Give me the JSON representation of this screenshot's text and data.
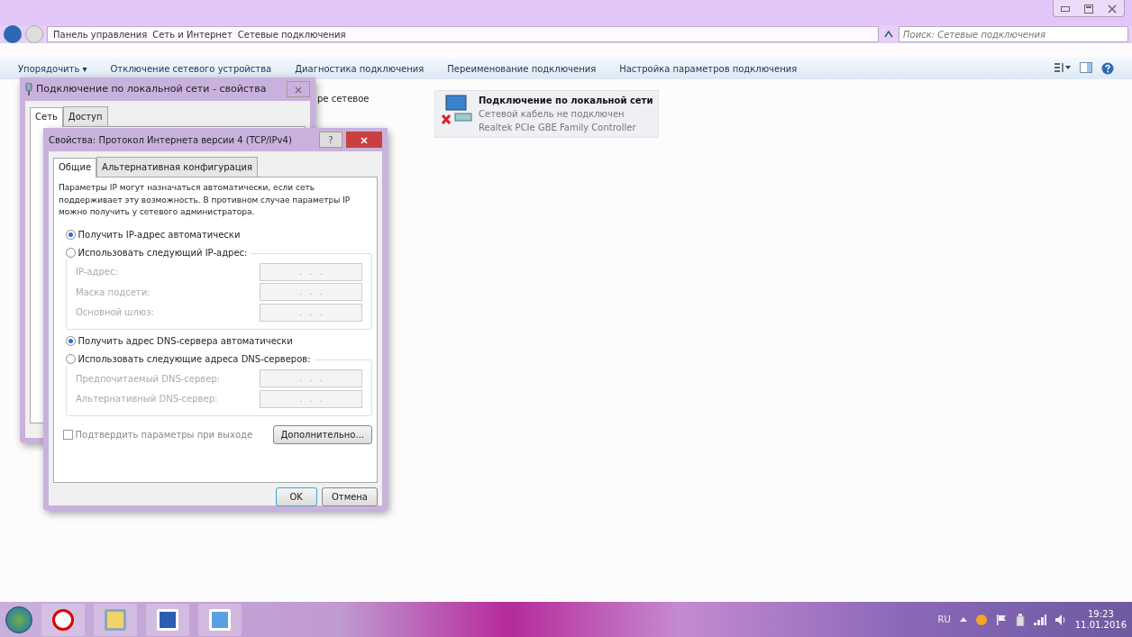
{
  "explorer": {
    "breadcrumb": [
      "Панель управления",
      "Сеть и Интернет",
      "Сетевые подключения"
    ],
    "search": {
      "placeholder": "Поиск: Сетевые подключения"
    },
    "toolbar": [
      "Упорядочить ▾",
      "Отключение сетевого устройства",
      "Диагностика подключения",
      "Переименование подключения",
      "Настройка параметров подключения"
    ],
    "partial_text": "ре сетевое",
    "connection": {
      "name": "Подключение по локальной сети",
      "status": "Сетевой кабель не подключен",
      "adapter": "Realtek PCIe GBE Family Controller",
      "disconnected": true
    }
  },
  "dialog_back": {
    "title": "Подключение по локальной сети - свойства",
    "tabs": [
      {
        "label": "Сеть",
        "selected": true
      },
      {
        "label": "Доступ",
        "selected": false
      }
    ]
  },
  "dialog": {
    "title": "Свойства: Протокол Интернета версии 4 (TCP/IPv4)",
    "help": "?",
    "tabs": [
      {
        "label": "Общие",
        "selected": true
      },
      {
        "label": "Альтернативная конфигурация",
        "selected": false
      }
    ],
    "description": "Параметры IP могут назначаться автоматически, если сеть поддерживает эту возможность. В противном случае параметры IP можно получить у сетевого администратора.",
    "groups": [
      {
        "auto": {
          "label": "Получить IP-адрес автоматически",
          "selected": true
        },
        "manual": {
          "label": "Использовать следующий IP-адрес:",
          "selected": false
        },
        "fields": [
          {
            "label": "IP-адрес:",
            "value": ".   .   .",
            "disabled": true
          },
          {
            "label": "Маска подсети:",
            "value": ".   .   .",
            "disabled": true
          },
          {
            "label": "Основной шлюз:",
            "value": ".   .   .",
            "disabled": true
          }
        ]
      },
      {
        "auto": {
          "label": "Получить адрес DNS-сервера автоматически",
          "selected": true
        },
        "manual": {
          "label": "Использовать следующие адреса DNS-серверов:",
          "selected": false
        },
        "fields": [
          {
            "label": "Предпочитаемый DNS-сервер:",
            "value": ".   .   .",
            "disabled": true
          },
          {
            "label": "Альтернативный DNS-сервер:",
            "value": ".   .   .",
            "disabled": true
          }
        ]
      }
    ],
    "confirm": {
      "label": "Подтвердить параметры при выходе",
      "checked": false
    },
    "advanced": "Дополнительно...",
    "ok": "OK",
    "cancel": "Отмена"
  },
  "taskbar": {
    "language": "RU",
    "time": "19:23",
    "date": "11.01.2016"
  }
}
